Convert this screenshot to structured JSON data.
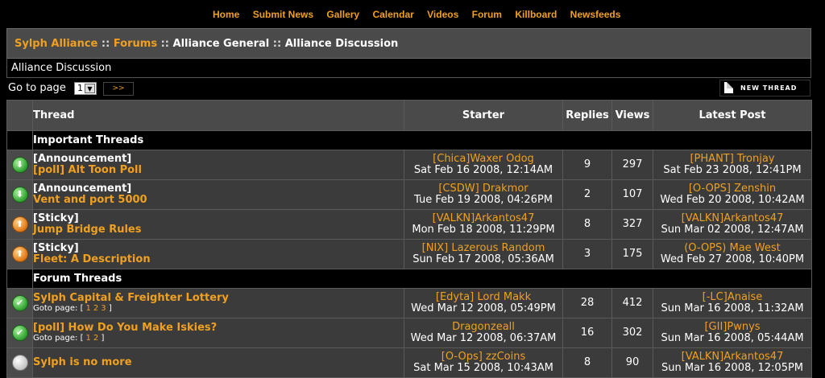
{
  "nav": {
    "items": [
      "Home",
      "Submit News",
      "Gallery",
      "Calendar",
      "Videos",
      "Forum",
      "Killboard",
      "Newsfeeds"
    ]
  },
  "breadcrumb": {
    "site": "Sylph Alliance",
    "forums": "Forums",
    "section": "Alliance General",
    "forum": "Alliance Discussion",
    "separator": "::"
  },
  "forum_title": "Alliance Discussion",
  "pager": {
    "label": "Go to page",
    "selected": "1",
    "go_label": ">>"
  },
  "new_thread_label": "NEW THREAD",
  "table": {
    "headers": {
      "thread": "Thread",
      "starter": "Starter",
      "replies": "Replies",
      "views": "Views",
      "latest": "Latest Post"
    },
    "important_label": "Important Threads",
    "forum_label": "Forum Threads",
    "goto_label": "Goto page:",
    "important": [
      {
        "icon": "green-down-arrow-icon",
        "prefix": "[Announcement]",
        "title": "[poll] Alt Toon Poll",
        "starter": "[Chica]Waxer Odog",
        "started": "Sat Feb 16 2008, 12:14AM",
        "replies": "9",
        "views": "297",
        "last_by": "[PHANT] Tronjay",
        "last_at": "Sat Feb 23 2008, 12:41PM"
      },
      {
        "icon": "green-down-arrow-icon",
        "prefix": "[Announcement]",
        "title": "Vent and port 5000",
        "starter": "[CSDW] Drakmor",
        "started": "Tue Feb 19 2008, 04:26PM",
        "replies": "2",
        "views": "107",
        "last_by": "[O-OPS] Zenshin",
        "last_at": "Wed Feb 20 2008, 10:42AM"
      },
      {
        "icon": "orange-up-arrow-icon",
        "prefix": "[Sticky]",
        "title": "Jump Bridge Rules",
        "starter": "[VALKN]Arkantos47",
        "started": "Mon Feb 18 2008, 11:29PM",
        "replies": "8",
        "views": "327",
        "last_by": "[VALKN]Arkantos47",
        "last_at": "Sun Mar 02 2008, 12:47AM"
      },
      {
        "icon": "orange-up-arrow-icon",
        "prefix": "[Sticky]",
        "title": "Fleet: A Description",
        "starter": "[NIX] Lazerous Random",
        "started": "Sun Feb 17 2008, 05:36AM",
        "replies": "3",
        "views": "175",
        "last_by": "(O-OPS) Mae West",
        "last_at": "Wed Feb 27 2008, 10:40PM"
      }
    ],
    "forum": [
      {
        "icon": "green-check-icon",
        "title": "Sylph Capital & Freighter Lottery",
        "pages": [
          "1",
          "2",
          "3"
        ],
        "starter": "[Edyta] Lord Makk",
        "started": "Wed Mar 12 2008, 05:49PM",
        "replies": "28",
        "views": "412",
        "last_by": "[-LC]Anaise",
        "last_at": "Sun Mar 16 2008, 11:32AM"
      },
      {
        "icon": "green-check-icon",
        "title": "[poll] How Do You Make Iskies?",
        "pages": [
          "1",
          "2"
        ],
        "starter": "Dragonzeall",
        "started": "Wed Mar 12 2008, 06:37AM",
        "replies": "16",
        "views": "302",
        "last_by": "[GII]Pwnys",
        "last_at": "Sun Mar 16 2008, 05:44AM"
      },
      {
        "icon": "grey-circle-icon",
        "title": "Sylph is no more",
        "pages": [],
        "starter": "[O-Ops] zzCoins",
        "started": "Sat Mar 15 2008, 10:43AM",
        "replies": "8",
        "views": "90",
        "last_by": "[VALKN]Arkantos47",
        "last_at": "Sun Mar 16 2008, 12:05PM"
      }
    ]
  }
}
